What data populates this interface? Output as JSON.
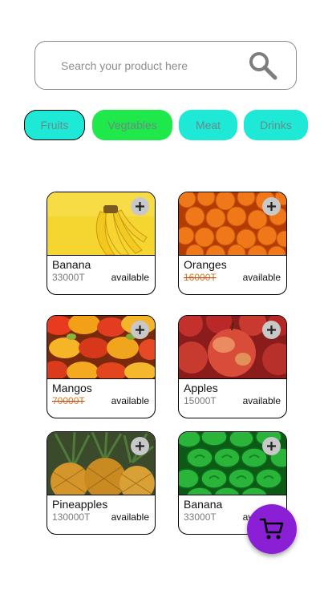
{
  "search": {
    "placeholder": "Search your product here"
  },
  "categories": [
    {
      "label": "Fruits",
      "color": "#1ee8d6",
      "active": true
    },
    {
      "label": "Vegtables",
      "color": "#1ee84a",
      "active": false
    },
    {
      "label": "Meat",
      "color": "#1ee8d6",
      "active": false
    },
    {
      "label": "Drinks",
      "color": "#1ee8d6",
      "active": false
    }
  ],
  "products": [
    {
      "name": "Banana",
      "price": "33000T",
      "status": "available",
      "image": "banana",
      "price_style": "normal"
    },
    {
      "name": "Oranges",
      "price": "16000T",
      "status": "available",
      "image": "oranges",
      "price_style": "sale"
    },
    {
      "name": "Mangos",
      "price": "70000T",
      "status": "available",
      "image": "mangos",
      "price_style": "sale"
    },
    {
      "name": "Apples",
      "price": "15000T",
      "status": "available",
      "image": "apples",
      "price_style": "normal"
    },
    {
      "name": "Pineapples",
      "price": "130000T",
      "status": "available",
      "image": "pineapples",
      "price_style": "normal"
    },
    {
      "name": "Banana",
      "price": "33000T",
      "status": "available",
      "image": "watermelons",
      "price_style": "normal"
    }
  ],
  "icons": {
    "search": "search-icon",
    "add": "plus-icon",
    "cart": "cart-icon"
  },
  "colors": {
    "accent_cart": "#8a1fd6",
    "chip_text": "#6c8a88",
    "sale_price": "#d97a1c"
  }
}
